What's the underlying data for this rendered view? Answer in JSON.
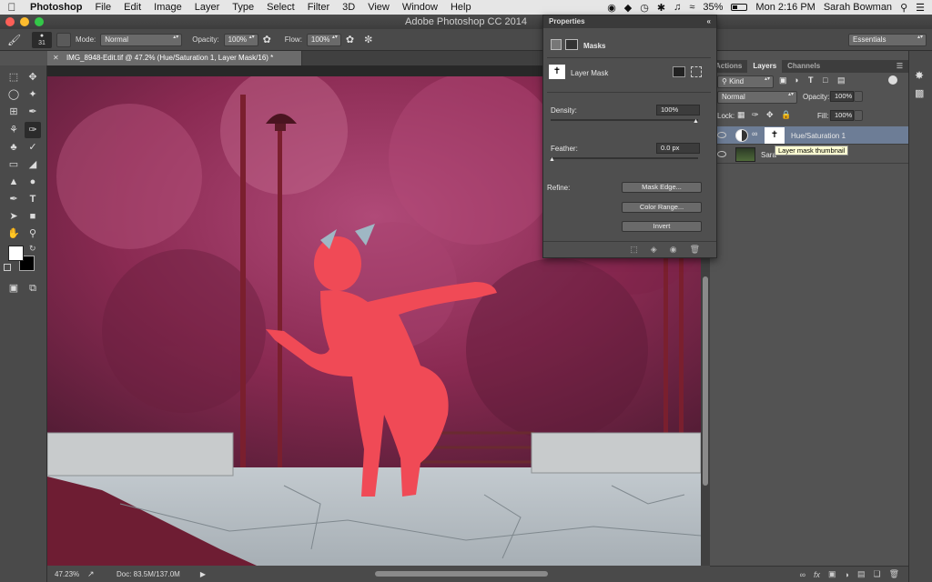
{
  "menubar": {
    "app": "Photoshop",
    "items": [
      "File",
      "Edit",
      "Image",
      "Layer",
      "Type",
      "Select",
      "Filter",
      "3D",
      "View",
      "Window",
      "Help"
    ],
    "battery": "35%",
    "clock": "Mon 2:16 PM",
    "user": "Sarah Bowman"
  },
  "window": {
    "title": "Adobe Photoshop CC 2014"
  },
  "options": {
    "brush_size": "31",
    "mode_label": "Mode:",
    "mode_value": "Normal",
    "opacity_label": "Opacity:",
    "opacity_value": "100%",
    "flow_label": "Flow:",
    "flow_value": "100%",
    "workspace": "Essentials"
  },
  "document": {
    "tab_title": "IMG_8948-Edit.tif @ 47.2% (Hue/Saturation 1, Layer Mask/16) *",
    "zoom": "47.23%",
    "doc_size": "Doc: 83.5M/137.0M"
  },
  "properties": {
    "title": "Properties",
    "section": "Masks",
    "mask_label": "Layer Mask",
    "density_label": "Density:",
    "density_value": "100%",
    "feather_label": "Feather:",
    "feather_value": "0.0 px",
    "refine_label": "Refine:",
    "buttons": {
      "mask_edge": "Mask Edge...",
      "color_range": "Color Range...",
      "invert": "Invert"
    }
  },
  "layers_panel": {
    "tabs": [
      "Actions",
      "Layers",
      "Channels"
    ],
    "filter": "Kind",
    "blend_mode": "Normal",
    "opacity_label": "Opacity:",
    "opacity_value": "100%",
    "lock_label": "Lock:",
    "fill_label": "Fill:",
    "fill_value": "100%",
    "layers": [
      {
        "name": "Hue/Saturation 1"
      },
      {
        "name": "Sara"
      }
    ],
    "tooltip": "Layer mask thumbnail"
  },
  "colors": {
    "app_bg": "#535353",
    "canvas_tree": "#8a2a52",
    "figure_red": "#f04a56",
    "pavement": "#b7bfc4",
    "selected_layer": "#6d7d96",
    "tooltip_bg": "#ffffd2"
  }
}
